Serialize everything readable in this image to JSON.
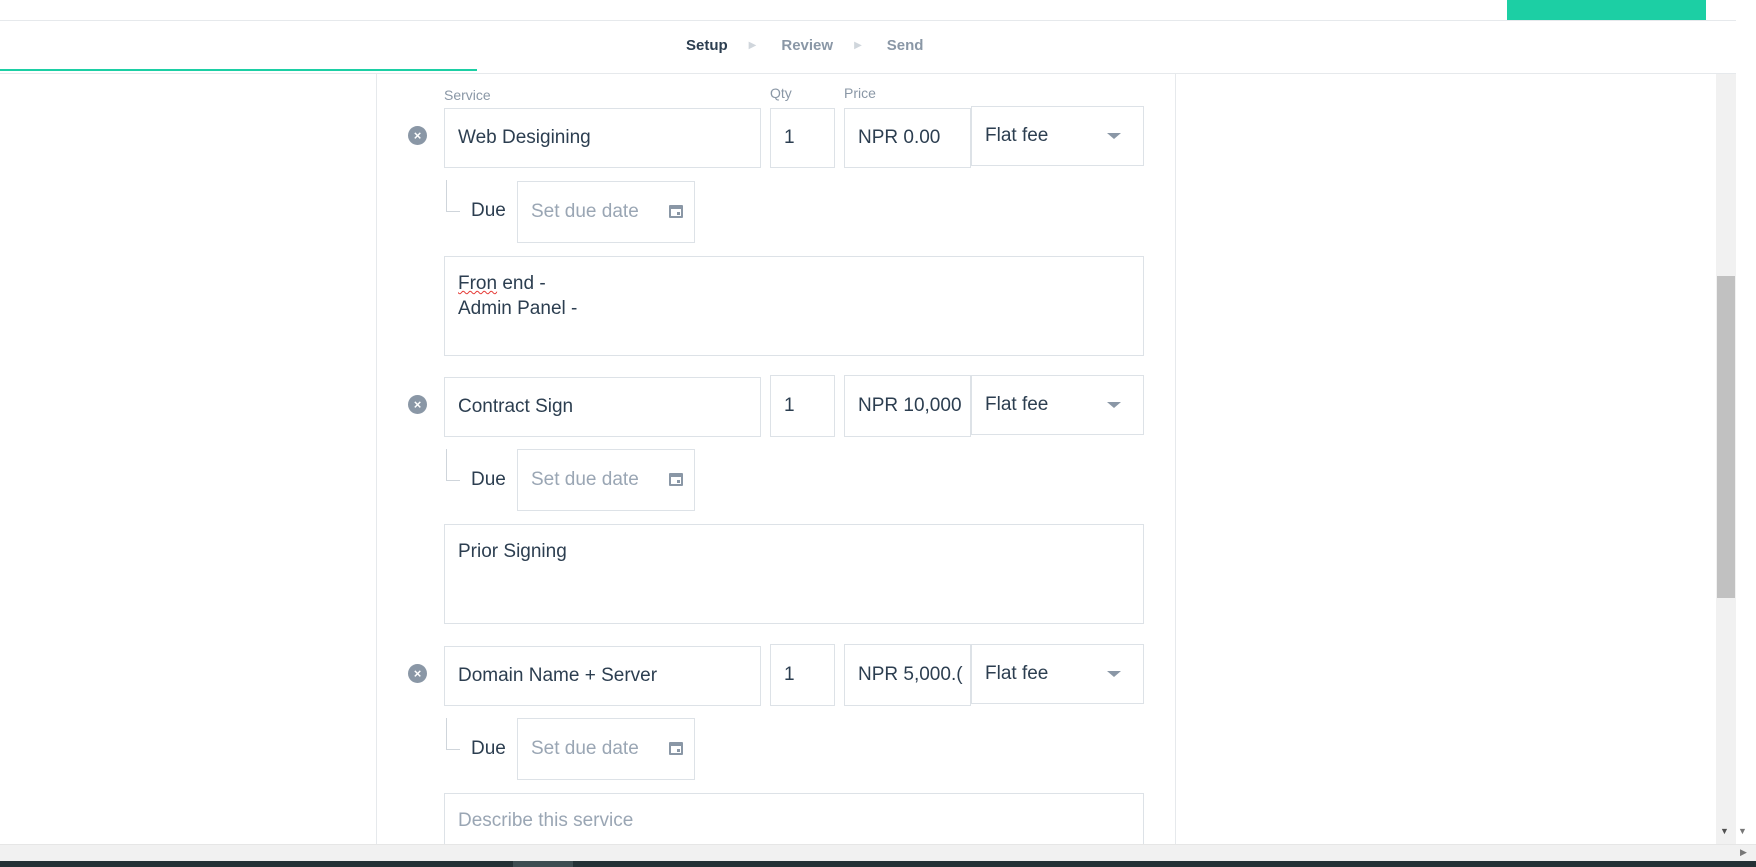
{
  "steps": [
    {
      "label": "Setup",
      "active": true
    },
    {
      "label": "Review",
      "active": false
    },
    {
      "label": "Send",
      "active": false
    }
  ],
  "columns": {
    "service": "Service",
    "qty": "Qty",
    "price": "Price"
  },
  "due_label": "Due",
  "due_placeholder": "Set due date",
  "items": [
    {
      "service": "Web Desigining",
      "qty": "1",
      "price": "NPR 0.00",
      "fee_type": "Flat fee",
      "description_lines": [
        "Fron end -",
        "Admin Panel -"
      ]
    },
    {
      "service": "Contract Sign",
      "qty": "1",
      "price": "NPR 10,000",
      "fee_type": "Flat fee",
      "description_lines": [
        "Prior Signing"
      ]
    },
    {
      "service": "Domain Name + Server",
      "qty": "1",
      "price": "NPR 5,000.(",
      "fee_type": "Flat fee",
      "description_placeholder": "Describe this service"
    }
  ],
  "icons": {
    "remove": "close-circle-icon",
    "calendar": "calendar-icon",
    "dropdown": "chevron-down-icon",
    "step_separator": "triangle-right-icon"
  },
  "colors": {
    "accent": "#1ccfa4",
    "text": "#2c3e50",
    "muted": "#8a97a6",
    "border": "#dde2e7"
  }
}
